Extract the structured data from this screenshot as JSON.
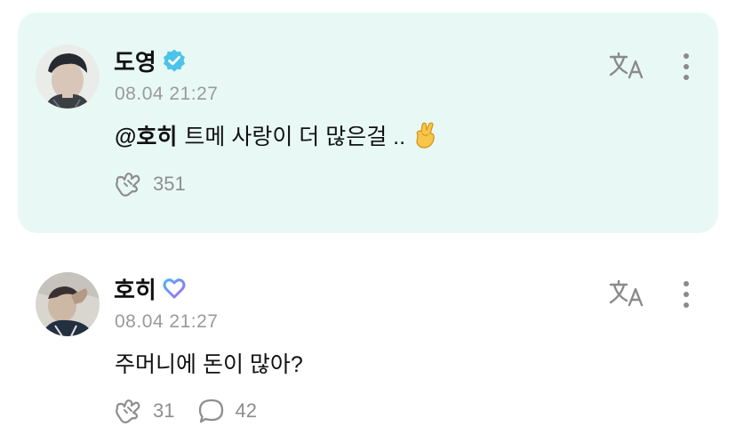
{
  "posts": [
    {
      "author": "도영",
      "badge_icon": "verified-check-icon",
      "badge_color": "#4cc3e8",
      "timestamp": "08.04 21:27",
      "mention": "@호히",
      "text": "트메 사랑이 더 많은걸 ..",
      "emoji_icon": "crossed-fingers-heart-icon",
      "like_count": "351",
      "highlighted": true
    },
    {
      "author": "호히",
      "badge_icon": "heart-outline-icon",
      "badge_color": "#8a7bf0",
      "timestamp": "08.04 21:27",
      "text": "주머니에 돈이 많아?",
      "like_count": "31",
      "comment_count": "42",
      "highlighted": false
    }
  ],
  "colors": {
    "highlight_bg": "#e8f9f5",
    "muted_text": "#9a9a9a",
    "icon_gray": "#8e8e8e"
  }
}
